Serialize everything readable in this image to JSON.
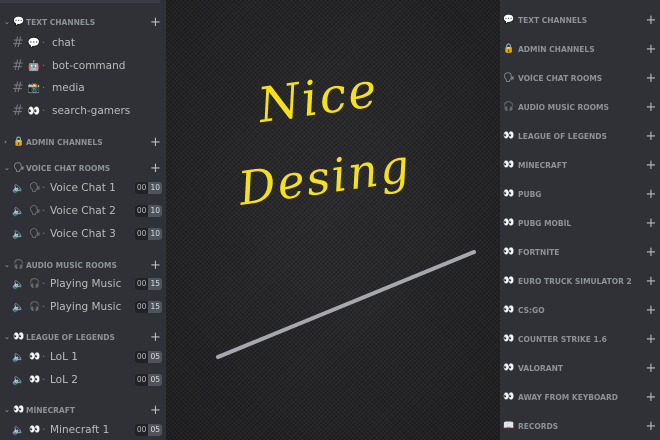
{
  "left": {
    "categories": {
      "text": {
        "icon": "💬",
        "label": "TEXT CHANNELS"
      },
      "admin": {
        "icon": "🔒",
        "label": "ADMİN CHANNELS"
      },
      "voice": {
        "icon": "🗣",
        "label": "VOİCE CHAT ROOMS"
      },
      "audio": {
        "icon": "🎧",
        "label": "AUDİO MUSİC ROOMS"
      },
      "lol": {
        "icon": "👀",
        "label": "LEAGUE OF LEGENDS"
      },
      "minecraft": {
        "icon": "👀",
        "label": "MİNECRAFT"
      }
    },
    "text_channels": [
      {
        "icon": "💬",
        "name": "chat"
      },
      {
        "icon": "🤖",
        "name": "bot-command"
      },
      {
        "icon": "📸",
        "name": "media"
      },
      {
        "icon": "👀",
        "name": "search-gamers"
      }
    ],
    "voice_channels": [
      {
        "icon": "🗣",
        "name": "Voice Chat 1",
        "count": "00",
        "limit": "10"
      },
      {
        "icon": "🗣",
        "name": "Voice Chat 2",
        "count": "00",
        "limit": "10"
      },
      {
        "icon": "🗣",
        "name": "Voice Chat 3",
        "count": "00",
        "limit": "10"
      }
    ],
    "audio_channels": [
      {
        "icon": "🎧",
        "name": "Playing Music",
        "count": "00",
        "limit": "15"
      },
      {
        "icon": "🎧",
        "name": "Playing Music",
        "count": "00",
        "limit": "15"
      }
    ],
    "lol_channels": [
      {
        "icon": "👀",
        "name": "LoL 1",
        "count": "00",
        "limit": "05"
      },
      {
        "icon": "👀",
        "name": "LoL 2",
        "count": "00",
        "limit": "05"
      }
    ],
    "minecraft_channels": [
      {
        "icon": "👀",
        "name": "Minecraft 1",
        "count": "00",
        "limit": "05"
      }
    ]
  },
  "center": {
    "line1": "Nice",
    "line2": "Desing"
  },
  "right": {
    "categories": [
      {
        "icon": "💬",
        "label": "TEXT CHANNELS"
      },
      {
        "icon": "🔒",
        "label": "ADMİN CHANNELS"
      },
      {
        "icon": "🗣",
        "label": "VOİCE CHAT ROOMS"
      },
      {
        "icon": "🎧",
        "label": "AUDİO MUSİC ROOMS"
      },
      {
        "icon": "👀",
        "label": "LEAGUE OF LEGENDS"
      },
      {
        "icon": "👀",
        "label": "MİNECRAFT"
      },
      {
        "icon": "👀",
        "label": "PUBG"
      },
      {
        "icon": "👀",
        "label": "PUBG MOBİL"
      },
      {
        "icon": "👀",
        "label": "FORTNİTE"
      },
      {
        "icon": "👀",
        "label": "EURO TRUCK SIMULATOR 2"
      },
      {
        "icon": "👀",
        "label": "CS:GO"
      },
      {
        "icon": "👀",
        "label": "COUNTER STRIKE 1.6"
      },
      {
        "icon": "👀",
        "label": "VALORANT"
      },
      {
        "icon": "👀",
        "label": "AWAY FROM KEYBOARD"
      },
      {
        "icon": "📖",
        "label": "RECORDS"
      }
    ]
  },
  "colors": {
    "panel": "#2f3136",
    "accent_text": "#f5e01d",
    "muted": "#8e9297"
  }
}
